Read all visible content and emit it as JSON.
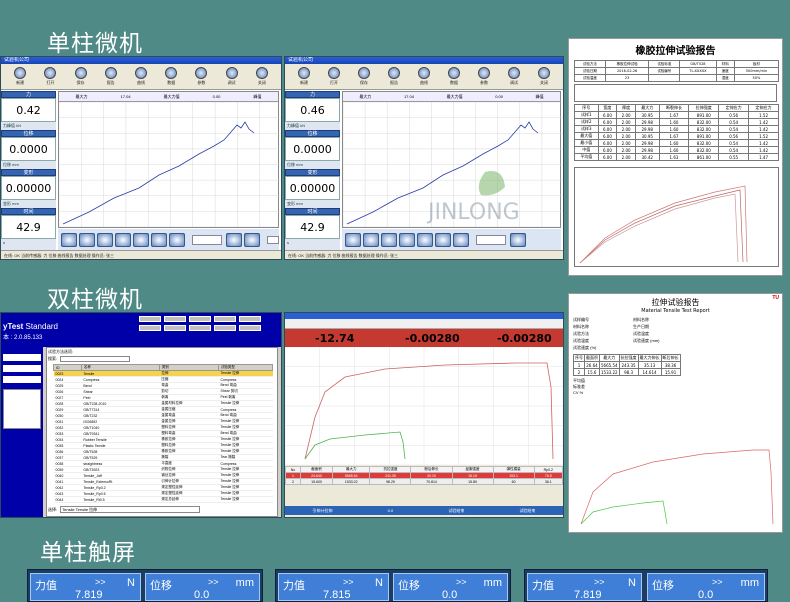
{
  "sections": {
    "single_micro": "单柱微机",
    "double_micro": "双柱微机",
    "single_touch": "单柱触屏"
  },
  "win1": {
    "title": "试验机公司",
    "toolbar": [
      "新建",
      "打开",
      "保存",
      "报告",
      "曲线",
      "数据",
      "参数",
      "调试",
      "关闭"
    ],
    "readouts": [
      {
        "head": "力",
        "value": "0.42",
        "sub": "力峰值 kN"
      },
      {
        "head": "位移",
        "value": "0.0000",
        "sub": "位移 mm"
      },
      {
        "head": "变形",
        "value": "0.00000",
        "sub": "变形 mm"
      },
      {
        "head": "时间",
        "value": "42.9",
        "sub": "s"
      }
    ],
    "chart_top": [
      "最大力",
      "17.04",
      "最大力值",
      "0.00",
      "峰值"
    ],
    "status": "在线: OK  当前传感器: 力  位移  曲线报告  数据处理  操作员: 张三"
  },
  "win2": {
    "readouts": [
      {
        "head": "力",
        "value": "0.46",
        "sub": "力峰值 kN"
      },
      {
        "head": "位移",
        "value": "0.0000",
        "sub": "位移 mm"
      },
      {
        "head": "变形",
        "value": "0.00000",
        "sub": "变形 mm"
      },
      {
        "head": "时间",
        "value": "42.9",
        "sub": "s"
      }
    ]
  },
  "report1": {
    "title": "橡胶拉伸试验报告",
    "header_rows": [
      [
        "试验方法",
        "橡胶拉伸试验",
        "试验标准",
        "GB/T528",
        "材料",
        "板材"
      ],
      [
        "试验日期",
        "2016-02-26",
        "试验编号",
        "TL-XXXXX",
        "速度",
        "500mm/min"
      ],
      [
        "试验温度",
        "23",
        "",
        "",
        "湿度",
        "50%"
      ]
    ],
    "table_head": [
      "序号",
      "宽度",
      "厚度",
      "最大力",
      "断裂伸长",
      "拉伸强度",
      "定伸应力",
      "定伸应力"
    ],
    "table_rows": [
      [
        "试样1",
        "6.00",
        "2.00",
        "30.95",
        "1.67",
        "891.00",
        "0.56",
        "1.52"
      ],
      [
        "试样2",
        "6.00",
        "2.00",
        "29.98",
        "1.60",
        "832.00",
        "0.54",
        "1.42"
      ],
      [
        "试样3",
        "6.00",
        "2.00",
        "29.98",
        "1.60",
        "832.00",
        "0.54",
        "1.42"
      ],
      [
        "最大值",
        "6.00",
        "2.00",
        "30.95",
        "1.67",
        "891.00",
        "0.56",
        "1.52"
      ],
      [
        "最小值",
        "6.00",
        "2.00",
        "29.98",
        "1.60",
        "832.00",
        "0.54",
        "1.42"
      ],
      [
        "中值",
        "6.00",
        "2.00",
        "29.98",
        "1.60",
        "832.00",
        "0.54",
        "1.42"
      ],
      [
        "平均值",
        "6.00",
        "2.00",
        "30.42",
        "1.63",
        "861.00",
        "0.55",
        "1.47"
      ]
    ]
  },
  "win3": {
    "brand": "yTest",
    "brand_suffix": " Standard",
    "version": "本 : 2.0.85.133",
    "list_title": "试验方法选项:",
    "search_label": "搜索:",
    "columns": [
      "ID",
      "名称",
      "类别",
      "试验类型"
    ],
    "rows": [
      [
        "0023",
        "Tensile",
        "拉伸",
        "Tensile 拉伸"
      ],
      [
        "0024",
        "Compress",
        "压缩",
        "Compress"
      ],
      [
        "0025",
        "Bend",
        "弯曲",
        "Bend 弯曲"
      ],
      [
        "0026",
        "Shear",
        "剪切",
        "Shear 剪切"
      ],
      [
        "0027",
        "Peel",
        "剥离",
        "Peel 剥离"
      ],
      [
        "0028",
        "GB/T228-2010",
        "金属材料拉伸",
        "Tensile 拉伸"
      ],
      [
        "0029",
        "GB/T7314",
        "金属压缩",
        "Compress"
      ],
      [
        "0030",
        "GB/T232",
        "金属弯曲",
        "Bend 弯曲"
      ],
      [
        "0031",
        "ISO6892",
        "金属拉伸",
        "Tensile 拉伸"
      ],
      [
        "0032",
        "GB/T1040",
        "塑料拉伸",
        "Tensile 拉伸"
      ],
      [
        "0033",
        "GB/T9341",
        "塑料弯曲",
        "Bend 弯曲"
      ],
      [
        "0034",
        "Rubber Tensile",
        "橡胶拉伸",
        "Tensile 拉伸"
      ],
      [
        "0035",
        "Plastic Tensile",
        "塑料拉伸",
        "Tensile 拉伸"
      ],
      [
        "0036",
        "GB/T528",
        "橡胶拉伸",
        "Tensile 拉伸"
      ],
      [
        "0037",
        "GB/T529",
        "撕裂",
        "Tear 撕裂"
      ],
      [
        "0038",
        "straightness",
        "平直度",
        "Compress"
      ],
      [
        "0039",
        "GB/T3923",
        "织物拉伸",
        "Tensile 拉伸"
      ],
      [
        "0040",
        "Tensile_Jaff",
        "钢丝拉伸",
        "Tensile 拉伸"
      ],
      [
        "0041",
        "Tensile_ExtensoRt",
        "引伸计拉伸",
        "Tensile 拉伸"
      ],
      [
        "0042",
        "Tensile_Rp0.2",
        "规定塑性延伸",
        "Tensile 拉伸"
      ],
      [
        "0043",
        "Tensile_Rp0.5",
        "规定塑性延伸",
        "Tensile 拉伸"
      ],
      [
        "0044",
        "Tensile_Rt0.5",
        "规定总延伸",
        "Tensile 拉伸"
      ]
    ],
    "footer_label": "选择:",
    "footer_value": "Tensile  Tensile 拉伸",
    "ok_label": "确定"
  },
  "win4": {
    "readouts": [
      "-12.74",
      "-0.00280",
      "-0.00280"
    ],
    "table_head": [
      "No",
      "截面积",
      "最大力",
      "抗拉强度",
      "断后伸长",
      "屈服强度",
      "弹性模量",
      "Rp0.2"
    ],
    "table_rows": [
      [
        "1",
        "24.640",
        "5665.54",
        "241.35",
        "30.10",
        "16.19",
        "153.1",
        "76.5"
      ],
      [
        "2",
        "15.600",
        "1533.22",
        "98.29",
        "70.814",
        "15.89",
        "60",
        "36.1"
      ]
    ],
    "status_items": [
      "引伸计拉伸",
      "0.0",
      "试验结束",
      "试验结束"
    ]
  },
  "report2": {
    "title": "拉伸试验报告",
    "subtitle": "Material Tensile Test Report",
    "fields": [
      "试样编号",
      "材料名称",
      "试验方法",
      "试验温度",
      "试验速度 (%)"
    ],
    "field_values": [
      "材料名称",
      "生产日期",
      "试验温度",
      "试验速度 (mm)",
      ""
    ],
    "table_head": [
      "序号",
      "截面积",
      "最大力",
      "抗拉强度",
      "最大力伸长",
      "断后伸长"
    ],
    "table_rows": [
      [
        "1",
        "26.64",
        "5665.54",
        "243.35",
        "35.13",
        "38.36"
      ],
      [
        "2",
        "15.6",
        "1533.22",
        "98.3",
        "14.614",
        "15.91"
      ]
    ],
    "stats": [
      "平均值",
      "标准差",
      "CV %"
    ],
    "tag": "TU"
  },
  "touch_panels": [
    {
      "force_label": "力值",
      "force_unit": "N",
      "force_value": "7.819",
      "disp_label": "位移",
      "disp_unit": "mm",
      "disp_value": "0.0"
    },
    {
      "force_label": "力值",
      "force_unit": "N",
      "force_value": "7.815",
      "disp_label": "位移",
      "disp_unit": "mm",
      "disp_value": "0.0"
    },
    {
      "force_label": "力值",
      "force_unit": "N",
      "force_value": "7.819",
      "disp_label": "位移",
      "disp_unit": "mm",
      "disp_value": "0.0"
    }
  ],
  "arrow_glyph": ">>"
}
